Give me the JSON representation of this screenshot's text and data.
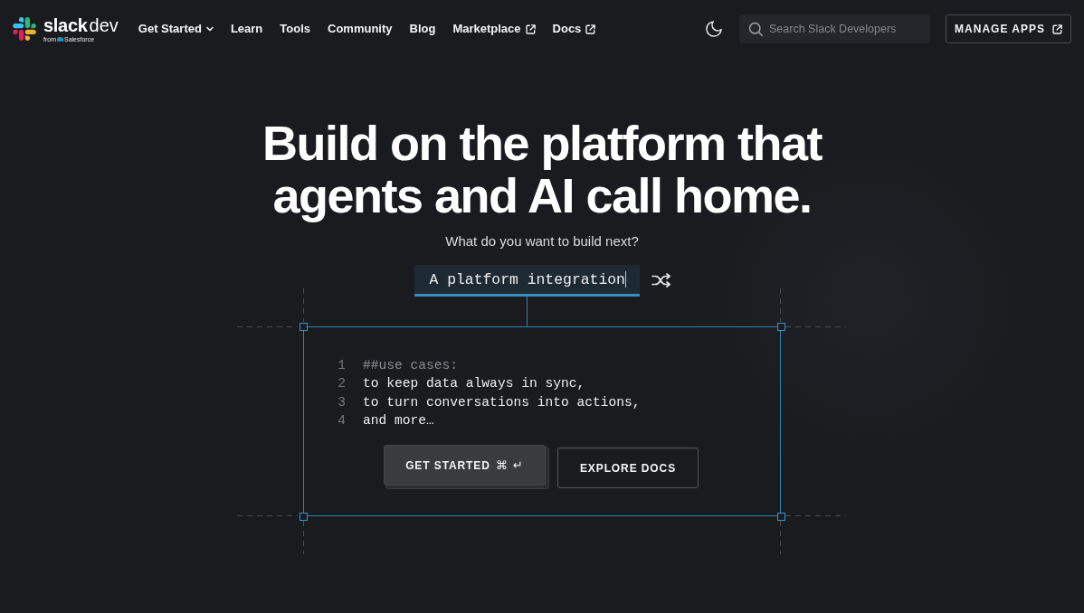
{
  "header": {
    "logo": {
      "wordmark": "slack",
      "wordmark_suffix": "dev",
      "byline": "from",
      "byline_brand": "Salesforce"
    },
    "nav_links": [
      {
        "label": "Get Started",
        "kind": "menu"
      },
      {
        "label": "Learn",
        "kind": "plain"
      },
      {
        "label": "Tools",
        "kind": "plain"
      },
      {
        "label": "Community",
        "kind": "plain"
      },
      {
        "label": "Blog",
        "kind": "plain"
      },
      {
        "label": "Marketplace",
        "kind": "external"
      },
      {
        "label": "Docs",
        "kind": "external"
      }
    ],
    "search": {
      "placeholder": "Search Slack Developers"
    },
    "manage_button": {
      "label": "MANAGE APPS",
      "kind": "external"
    }
  },
  "hero": {
    "title_lines": [
      "Build on the platform that",
      "agents and AI call home."
    ],
    "prompt": "What do you want to build next?",
    "idea_field": {
      "value": "A platform integration"
    },
    "editor": {
      "lines": [
        {
          "number": "1",
          "text": "##use cases:",
          "kind": "comment"
        },
        {
          "number": "2",
          "text": "to keep data always in sync,",
          "kind": "code"
        },
        {
          "number": "3",
          "text": "to turn conversations into actions,",
          "kind": "code"
        },
        {
          "number": "4",
          "text": "and more…",
          "kind": "code"
        }
      ],
      "buttons": [
        {
          "label": "GET STARTED",
          "shortcut": "⌘ ↵",
          "kind": "primary"
        },
        {
          "label": "EXPLORE DOCS",
          "kind": "secondary"
        }
      ]
    }
  }
}
